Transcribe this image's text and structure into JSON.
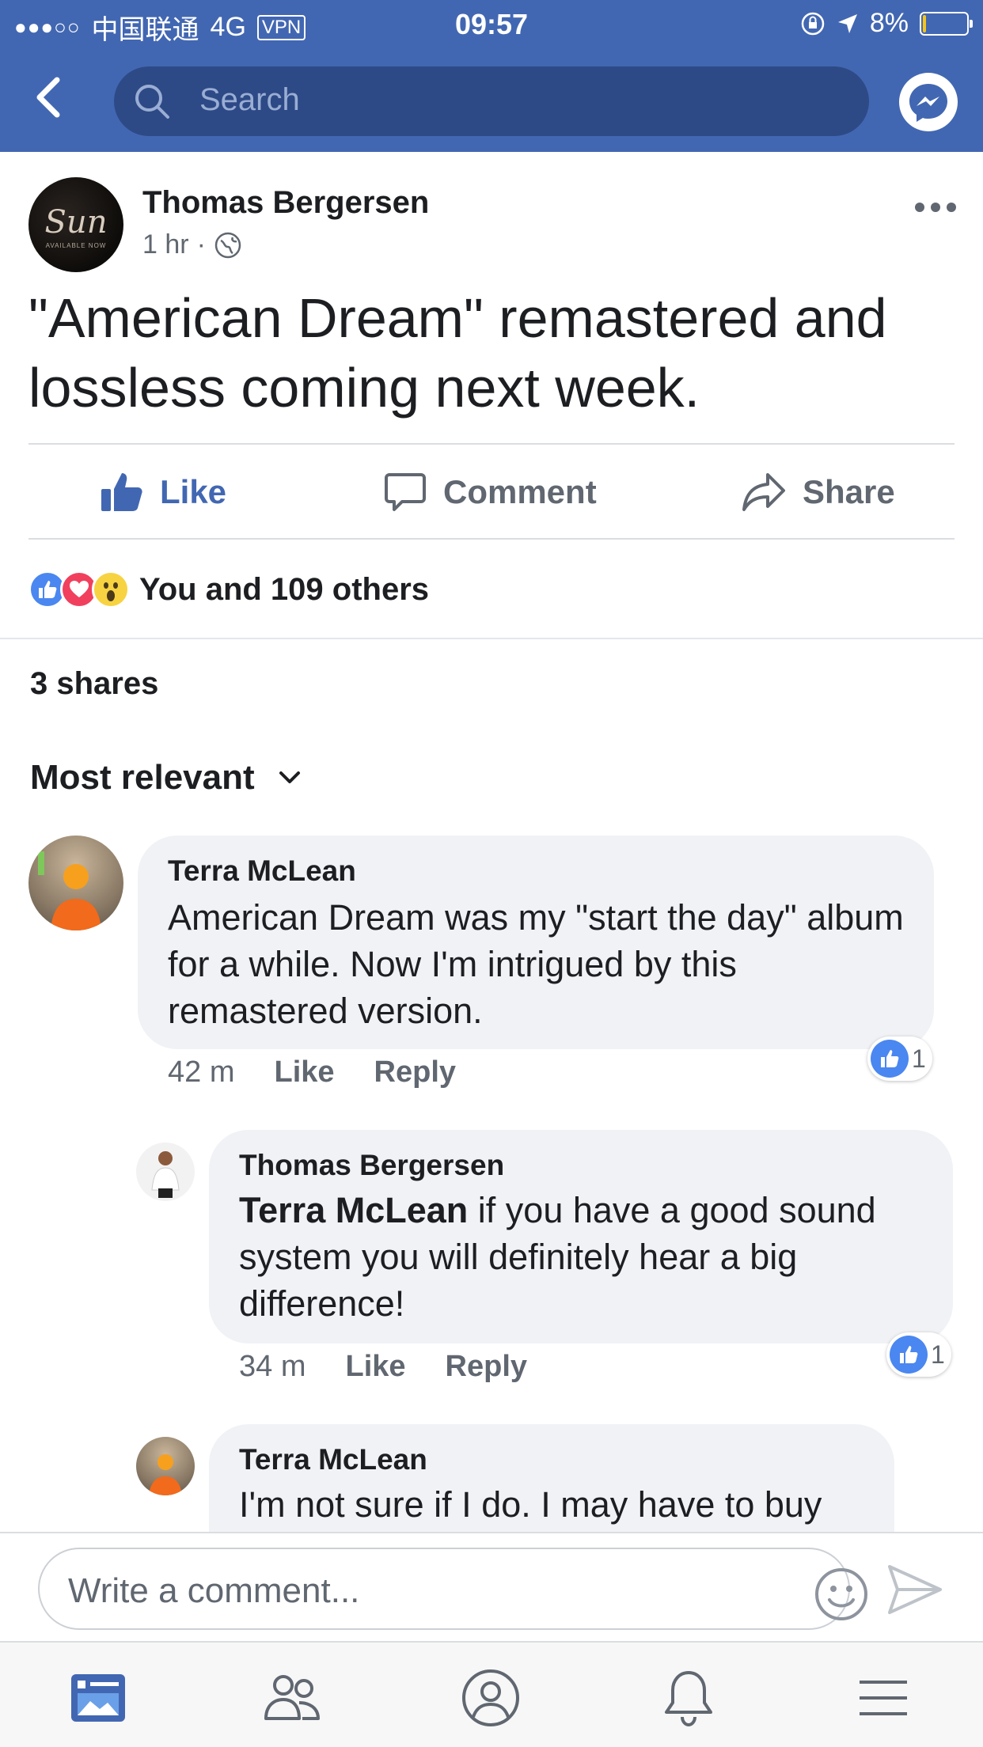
{
  "status_bar": {
    "carrier": "中国联通",
    "network": "4G",
    "vpn": "VPN",
    "time": "09:57",
    "battery": "8%",
    "battery_level": 0.08
  },
  "header": {
    "search_placeholder": "Search",
    "back_icon": "chevron-left-icon",
    "messenger_icon": "messenger-icon"
  },
  "post": {
    "author": "Thomas Bergersen",
    "time": "1 hr",
    "separator": "·",
    "avatar_logo": "Sun",
    "avatar_caption": "AVAILABLE NOW",
    "text": "\"American Dream\" remastered and lossless coming next week.",
    "actions": {
      "like": "Like",
      "comment": "Comment",
      "share": "Share"
    },
    "reactions_text": "You and 109 others",
    "shares_text": "3 shares",
    "sort_label": "Most relevant"
  },
  "comments": [
    {
      "author": "Terra McLean",
      "text": "American Dream was my \"start the day\" album for a while. Now I'm intrigued by this remastered version.",
      "time": "42 m",
      "like_label": "Like",
      "reply_label": "Reply",
      "likes": "1"
    },
    {
      "author": "Thomas Bergersen",
      "mention": "Terra McLean",
      "text": " if you have a good sound system you will definitely hear a big difference!",
      "time": "34 m",
      "like_label": "Like",
      "reply_label": "Reply",
      "likes": "1"
    },
    {
      "author": "Terra McLean",
      "text": "I'm not sure if I do. I may have to buy"
    }
  ],
  "composer": {
    "placeholder": "Write a comment..."
  },
  "colors": {
    "brand": "#4267b2",
    "like_blue": "#4a87f0",
    "love_red": "#f0405d",
    "wow_yellow": "#f7d342"
  }
}
